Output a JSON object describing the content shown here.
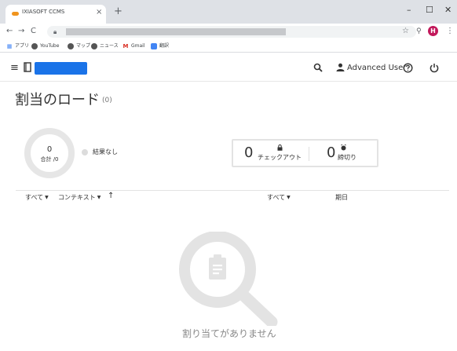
{
  "browser": {
    "tab_title": "IXIASOFT CCMS",
    "tab_close": "×",
    "new_tab": "+",
    "window_controls": {
      "minimize": "–",
      "maximize": "☐",
      "close": "✕"
    },
    "nav": {
      "back": "←",
      "forward": "→",
      "reload": "C"
    },
    "profile_initial": "H",
    "bookmarks": [
      {
        "label": "アプリ",
        "icon": "apps-grid-icon"
      },
      {
        "label": "YouTube",
        "icon": "globe-icon"
      },
      {
        "label": "マップ",
        "icon": "globe-icon"
      },
      {
        "label": "ニュース",
        "icon": "globe-icon"
      },
      {
        "label": "Gmail",
        "icon": "gmail-icon"
      },
      {
        "label": "翻訳",
        "icon": "translate-icon"
      }
    ]
  },
  "app": {
    "user_label": "Advanced User",
    "brand_color": "#1a73e8"
  },
  "page": {
    "title": "割当のロード",
    "count": "(0)",
    "donut": {
      "value": "0",
      "total_label": "合計 /0"
    },
    "legend": {
      "label": "結果なし",
      "color": "#dcdcdc"
    },
    "stats": {
      "checkout": {
        "value": "0",
        "label": "チェックアウト",
        "icon": "lock-icon"
      },
      "deadline": {
        "value": "0",
        "label": "締切り",
        "icon": "alarm-icon"
      }
    },
    "filters": {
      "all_1": "すべて",
      "context": "コンテキスト",
      "all_2": "すべて",
      "due_date": "期日"
    },
    "empty_message": "割り当てがありません"
  }
}
